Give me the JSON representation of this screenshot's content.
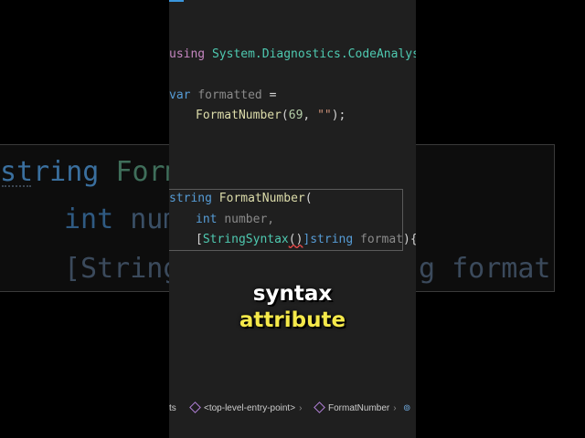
{
  "background": {
    "line1_kw": "string",
    "line1_fn": "Form",
    "line2_kw": "int",
    "line2_var": "num",
    "line3_open": "[String",
    "line3_tail": "g format){."
  },
  "editor": {
    "using_kw": "using",
    "using_ns": "System.Diagnostics.CodeAnalys",
    "var_kw": "var",
    "var_name": "formatted",
    "assign": "=",
    "call_fn": "FormatNumber",
    "call_open": "(",
    "call_num": "69",
    "call_sep": ", ",
    "call_str": "\"\"",
    "call_close": ");"
  },
  "peek": {
    "ret_kw": "string",
    "fn_name": "FormatNumber",
    "open_paren": "(",
    "int_kw": "int",
    "param_number": "number,",
    "attr_open": "[",
    "attr_name": "StringSyntax",
    "attr_parens": "()",
    "attr_close_kw": "]string",
    "param_format": "format",
    "tail": "){."
  },
  "captions": {
    "line1": "syntax",
    "line2": "attribute"
  },
  "statusbar": {
    "left_fragment": "ts",
    "entry_point": "<top-level-entry-point>",
    "method": "FormatNumber"
  },
  "colors": {
    "editor_bg": "#1f1f1f",
    "keyword": "#569cd6",
    "function": "#dcdcaa",
    "type": "#4ec9b0",
    "caption_highlight": "#f5e94a"
  }
}
